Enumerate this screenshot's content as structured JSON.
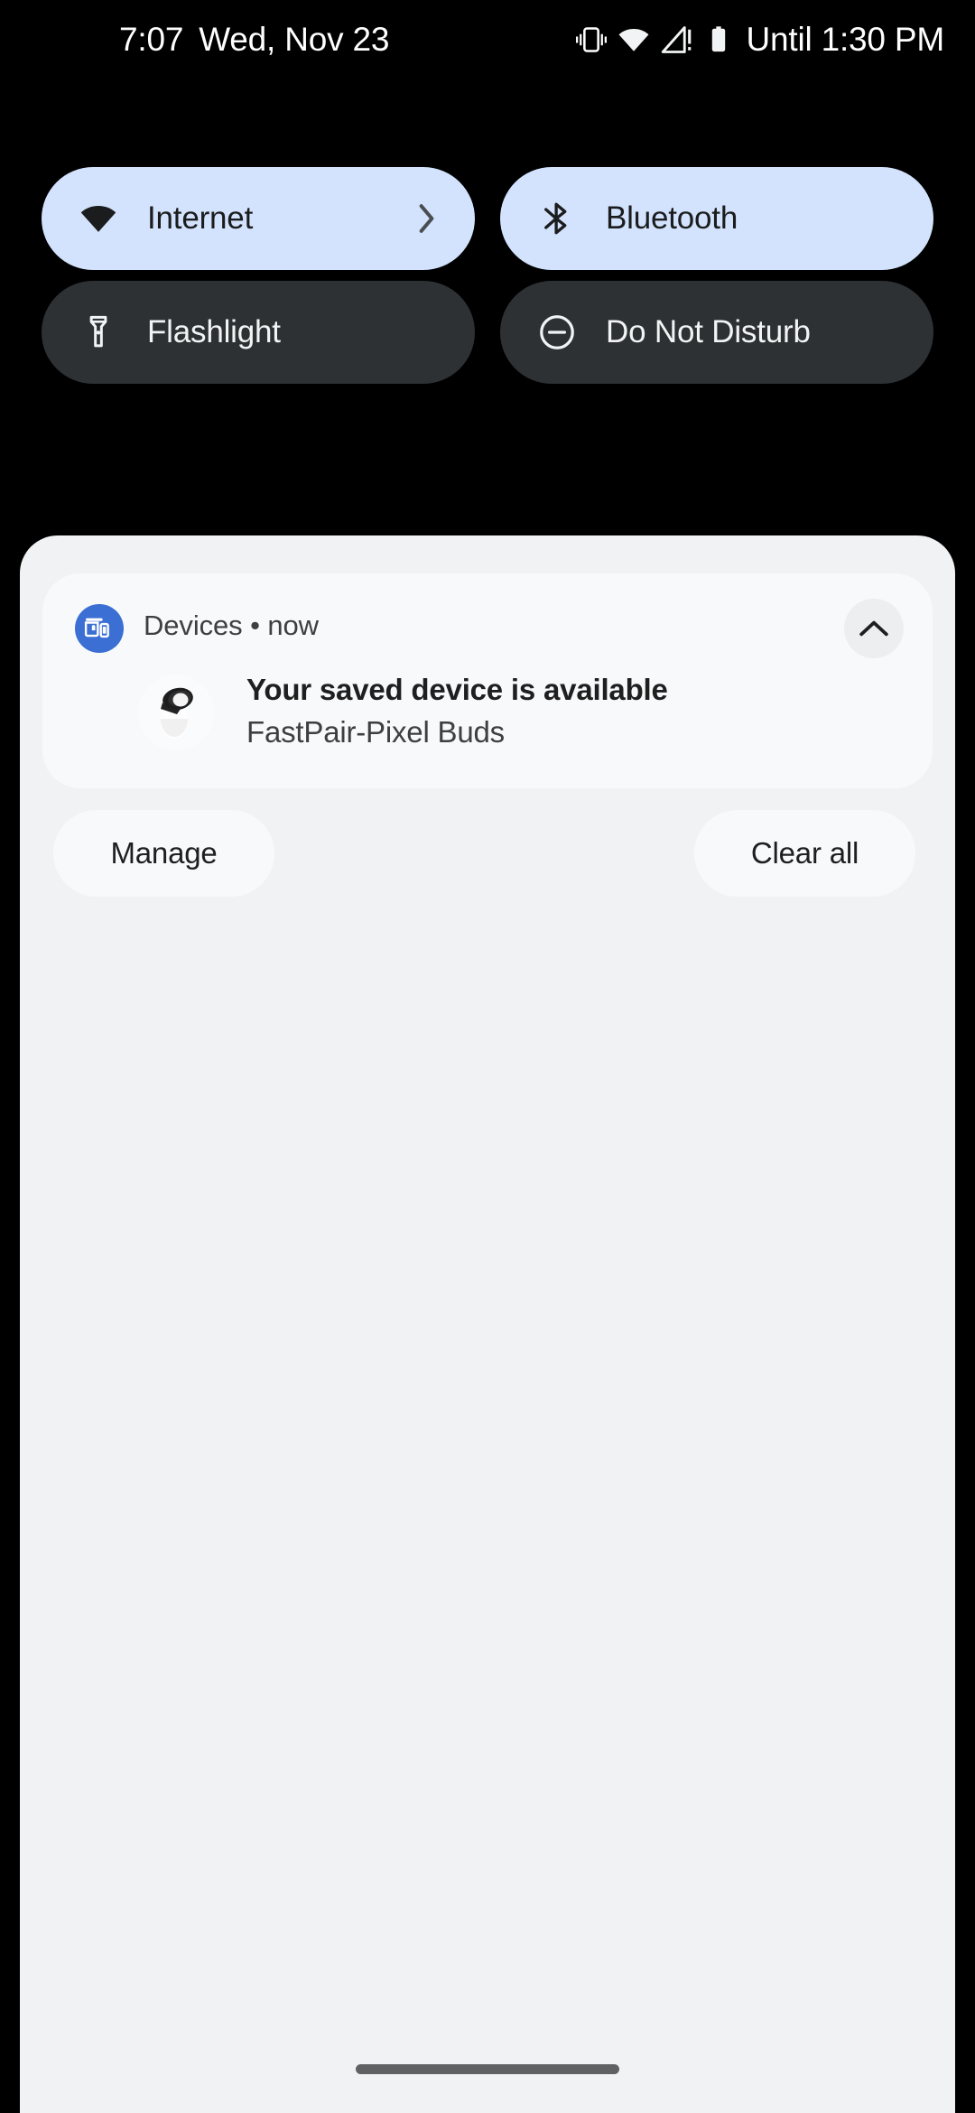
{
  "status_bar": {
    "clock": "7:07",
    "date": "Wed, Nov 23",
    "dnd_until": "Until 1:30 PM",
    "icons": [
      {
        "name": "vibrate-icon"
      },
      {
        "name": "wifi-icon"
      },
      {
        "name": "no-signal-alert-icon"
      },
      {
        "name": "battery-full-icon"
      }
    ]
  },
  "quick_settings": {
    "tiles": [
      {
        "id": "internet",
        "label": "Internet",
        "icon": "wifi-icon",
        "state": "active",
        "has_chevron": true
      },
      {
        "id": "bluetooth",
        "label": "Bluetooth",
        "icon": "bluetooth-icon",
        "state": "active",
        "has_chevron": false
      },
      {
        "id": "flashlight",
        "label": "Flashlight",
        "icon": "flashlight-icon",
        "state": "inactive",
        "has_chevron": false
      },
      {
        "id": "do-not-disturb",
        "label": "Do Not Disturb",
        "icon": "do-not-disturb-icon",
        "state": "inactive",
        "has_chevron": false
      }
    ],
    "active_bg": "#d3e3fd",
    "inactive_bg": "#2e3133"
  },
  "notification": {
    "app_name": "Devices",
    "separator": "•",
    "time": "now",
    "header_text": "Devices • now",
    "app_icon": "devices-cast-icon",
    "expand_icon": "chevron-up-icon",
    "title": "Your saved device is available",
    "subtitle": "FastPair-Pixel Buds",
    "thumbnail": "pixel-buds-earbud-image",
    "app_icon_color": "#3b6fd4"
  },
  "shade": {
    "manage_label": "Manage",
    "clear_all_label": "Clear all",
    "background": "#f1f2f3",
    "card_background": "#f8f9fa"
  },
  "nav_bar": {
    "handle": "gesture-home-handle"
  }
}
